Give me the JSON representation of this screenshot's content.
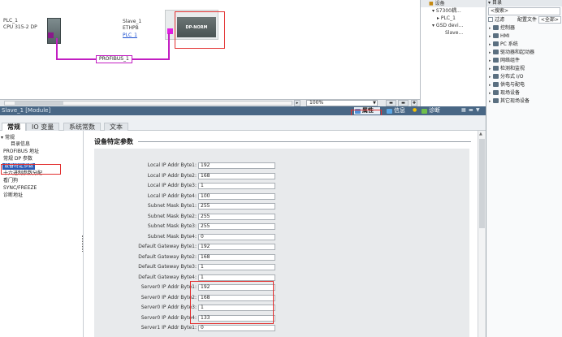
{
  "network": {
    "plc_name": "PLC_1",
    "plc_cpu": "CPU 315-2 DP",
    "slave_name": "Slave_1",
    "slave_type": "ETHPB",
    "slave_master_link": "PLC_1",
    "slave_module_text": "DP-NORM",
    "bus_name": "PROFIBUS_1"
  },
  "overview": {
    "title": "设备",
    "items": [
      "S7300耦...",
      "PLC_1",
      "GSD devi...",
      "Slave..."
    ]
  },
  "canvas_bar": {
    "zoom": "100%"
  },
  "catalog": {
    "title": "目录",
    "search_placeholder": "<搜索>",
    "filter_label": "过滤",
    "profile_label": "配置文件",
    "profile_value": "<全部>",
    "items": [
      "控制器",
      "HMI",
      "PC 系统",
      "驱动器和起动器",
      "网络组件",
      "检测和监视",
      "分布式 I/O",
      "供电与配电",
      "现场设备",
      "其它现场设备"
    ]
  },
  "properties": {
    "title": "Slave_1 [Module]",
    "tabs": {
      "properties": "属性",
      "info": "信息",
      "diagnostics": "诊断"
    }
  },
  "editor_tabs": [
    "常规",
    "IO 变量",
    "系统常数",
    "文本"
  ],
  "nav": {
    "items": [
      "常规",
      "目录信息",
      "PROFIBUS 地址",
      "常规 DP 参数",
      "设备特定参数",
      "十六进制参数分配",
      "看门狗",
      "SYNC/FREEZE",
      "诊断地址"
    ]
  },
  "content": {
    "section_title": "设备特定参数",
    "params": [
      {
        "label": "Local IP Addr Byte1:",
        "value": "192"
      },
      {
        "label": "Local IP Addr Byte2:",
        "value": "168"
      },
      {
        "label": "Local IP Addr Byte3:",
        "value": "1"
      },
      {
        "label": "Local IP Addr Byte4:",
        "value": "100"
      },
      {
        "label": "Subnet Mask Byte1:",
        "value": "255"
      },
      {
        "label": "Subnet Mask Byte2:",
        "value": "255"
      },
      {
        "label": "Subnet Mask Byte3:",
        "value": "255"
      },
      {
        "label": "Subnet Mask Byte4:",
        "value": "0"
      },
      {
        "label": "Default Gateway Byte1:",
        "value": "192"
      },
      {
        "label": "Default Gateway Byte2:",
        "value": "168"
      },
      {
        "label": "Default Gateway Byte3:",
        "value": "1"
      },
      {
        "label": "Default Gateway Byte4:",
        "value": "1"
      },
      {
        "label": "Server0 IP Addr Byte1:",
        "value": "192"
      },
      {
        "label": "Server0 IP Addr Byte2:",
        "value": "168"
      },
      {
        "label": "Server0 IP Addr Byte3:",
        "value": "1"
      },
      {
        "label": "Server0 IP Addr Byte4:",
        "value": "133"
      },
      {
        "label": "Server1 IP Addr Byte1:",
        "value": "0"
      }
    ]
  }
}
